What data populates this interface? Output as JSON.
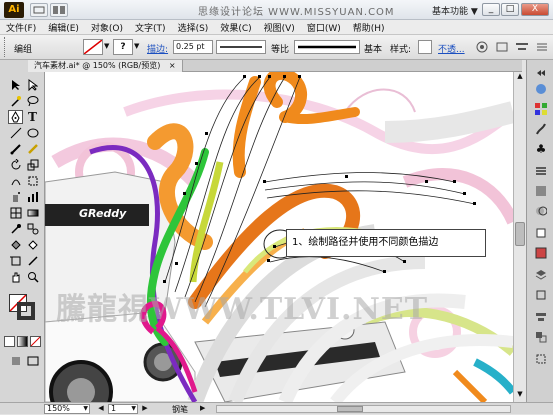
{
  "app": {
    "logo": "Ai",
    "watermark": "思缘设计论坛  WWW.MISSYUAN.COM",
    "workspace": "基本功能",
    "workspace_arrow": "▼",
    "win_min": "_",
    "win_max": "□",
    "win_close": "X"
  },
  "menu": {
    "items": [
      "文件(F)",
      "编辑(E)",
      "对象(O)",
      "文字(T)",
      "选择(S)",
      "效果(C)",
      "视图(V)",
      "窗口(W)",
      "帮助(H)"
    ]
  },
  "control": {
    "label": "编组",
    "stroke_label": "描边:",
    "stroke_value": "0.25 pt",
    "profile_label": "等比",
    "brush_label": "基本",
    "style_label": "样式:",
    "opacity_label": "不透..."
  },
  "document": {
    "tab_title": "汽车素材.ai* @ 150% (RGB/预览)"
  },
  "canvas": {
    "callout_text": "1、绘制路径并使用不同颜色描边",
    "watermark": "騰龍視WWW.TLVI.NET"
  },
  "status": {
    "zoom": "150%",
    "page": "1",
    "tool": "钢笔"
  },
  "colors": {
    "orange": "#f08a1c",
    "purple": "#7b2bc0",
    "green": "#2ec53a",
    "magenta": "#e0198c",
    "yellow_green": "#c7d83a",
    "cyan": "#27b0c9"
  }
}
